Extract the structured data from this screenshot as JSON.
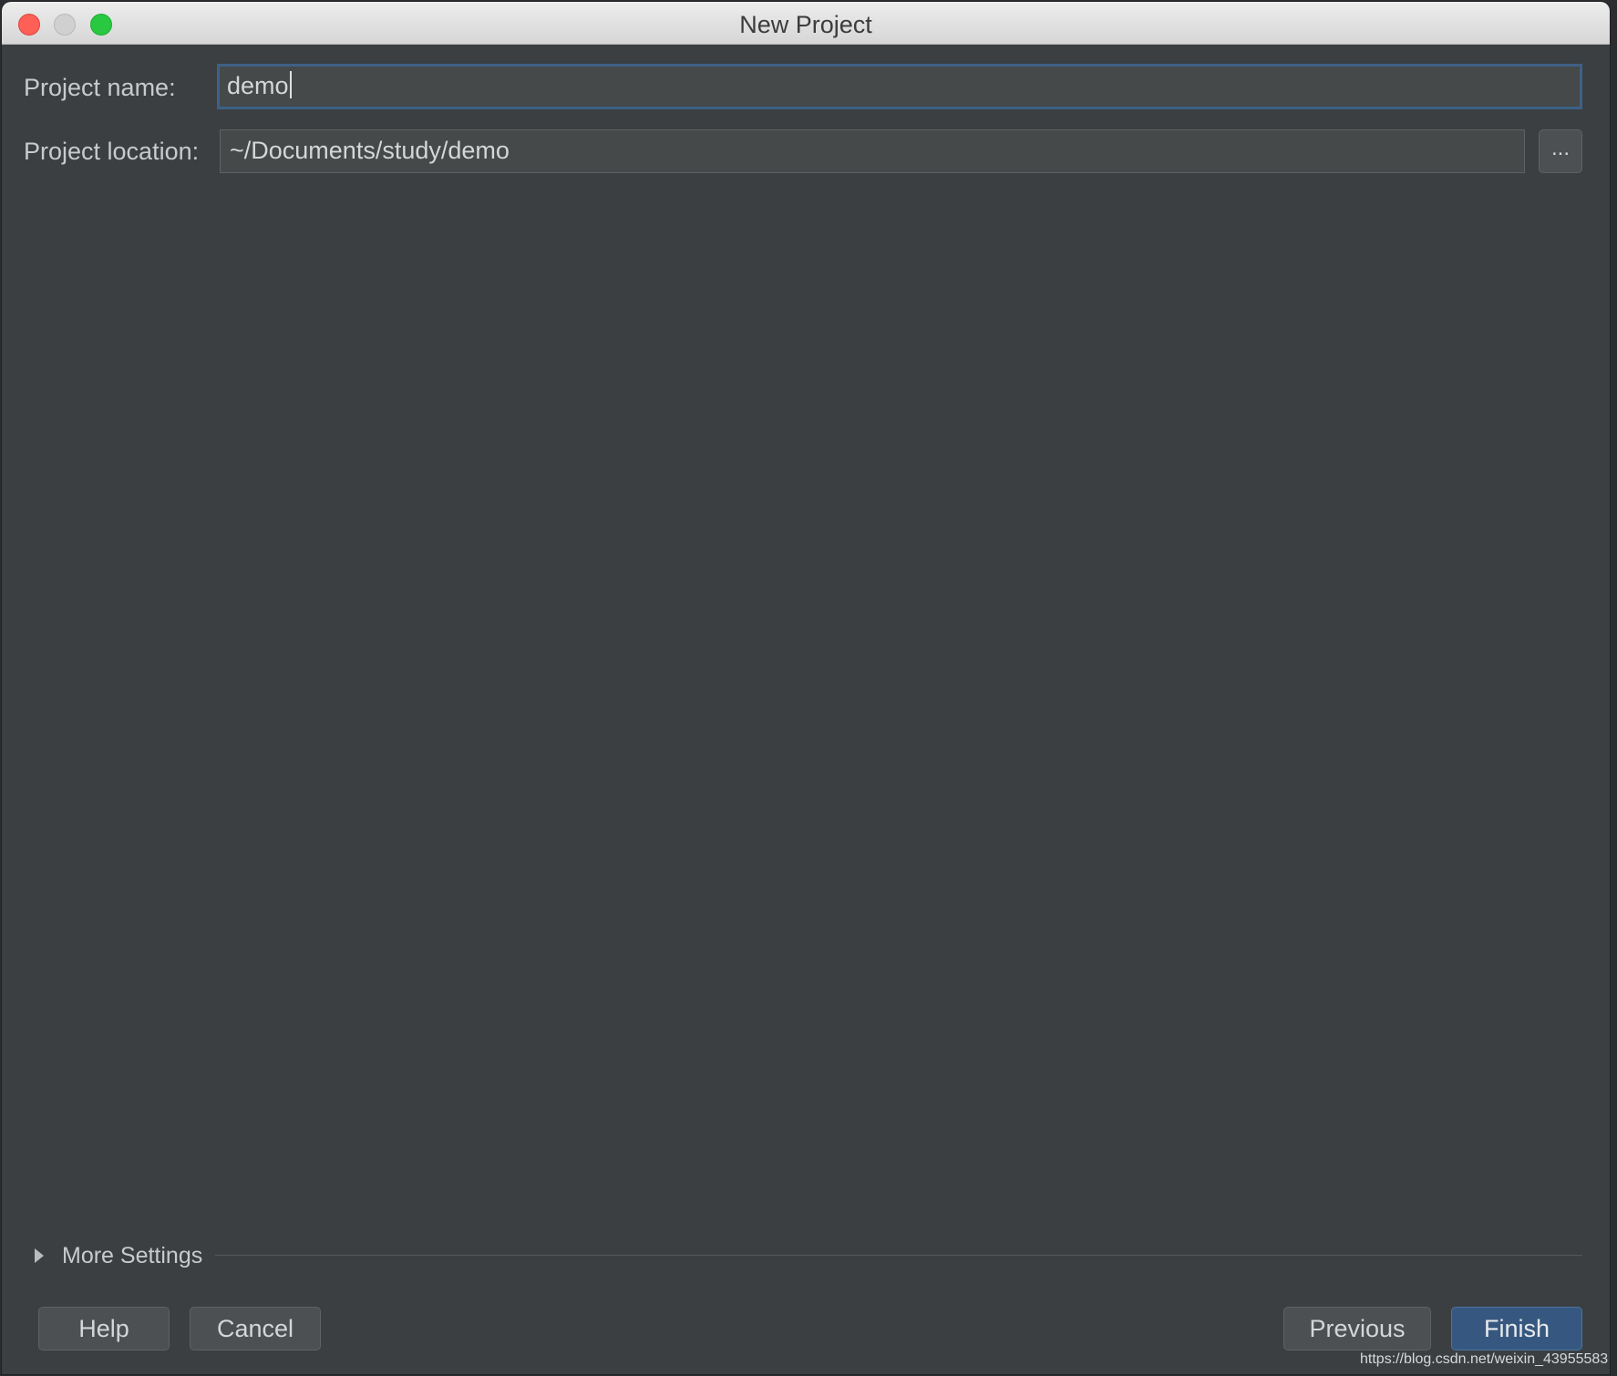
{
  "window": {
    "title": "New Project"
  },
  "form": {
    "project_name": {
      "label": "Project name:",
      "value": "demo"
    },
    "project_location": {
      "label": "Project location:",
      "value": "~/Documents/study/demo",
      "browse_label": "..."
    }
  },
  "more_settings": {
    "label": "More Settings",
    "icon": "triangle-right-icon"
  },
  "buttons": {
    "help": "Help",
    "cancel": "Cancel",
    "previous": "Previous",
    "finish": "Finish"
  },
  "watermark": "https://blog.csdn.net/weixin_43955583",
  "colors": {
    "accent": "#365880",
    "focus_border": "#3d6185",
    "background": "#3b3f42"
  }
}
